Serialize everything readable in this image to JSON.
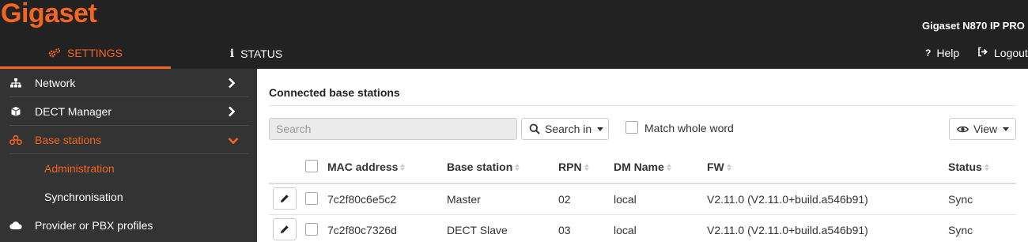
{
  "header": {
    "logo": "Gigaset",
    "device_name": "Gigaset N870 IP PRO",
    "tabs": [
      {
        "label": "SETTINGS",
        "icon": "gears-icon",
        "active": true
      },
      {
        "label": "STATUS",
        "icon": "info-icon",
        "active": false
      }
    ],
    "help_label": "Help",
    "logout_label": "Logout"
  },
  "sidebar": {
    "items": [
      {
        "label": "Network",
        "icon": "network-icon"
      },
      {
        "label": "DECT Manager",
        "icon": "box-icon"
      },
      {
        "label": "Base stations",
        "icon": "base-stations-icon",
        "expanded": true
      },
      {
        "label": "Administration",
        "sub": true,
        "current": true
      },
      {
        "label": "Synchronisation",
        "sub": true
      },
      {
        "label": "Provider or PBX profiles",
        "icon": "cloud-icon"
      }
    ]
  },
  "main": {
    "section_title": "Connected base stations",
    "search_placeholder": "Search",
    "search_in_label": "Search in",
    "match_whole_word_label": "Match whole word",
    "view_label": "View",
    "columns": [
      "MAC address",
      "Base station",
      "RPN",
      "DM Name",
      "FW",
      "Status"
    ],
    "rows": [
      {
        "mac": "7c2f80c6e5c2",
        "base_station": "Master",
        "rpn": "02",
        "dm_name": "local",
        "fw": "V2.11.0 (V2.11.0+build.a546b91)",
        "status": "Sync"
      },
      {
        "mac": "7c2f80c7326d",
        "base_station": "DECT Slave",
        "rpn": "03",
        "dm_name": "local",
        "fw": "V2.11.0 (V2.11.0+build.a546b91)",
        "status": "Sync"
      }
    ]
  },
  "colors": {
    "accent": "#f26522",
    "topbar": "#222222",
    "sidebar": "#333333"
  }
}
